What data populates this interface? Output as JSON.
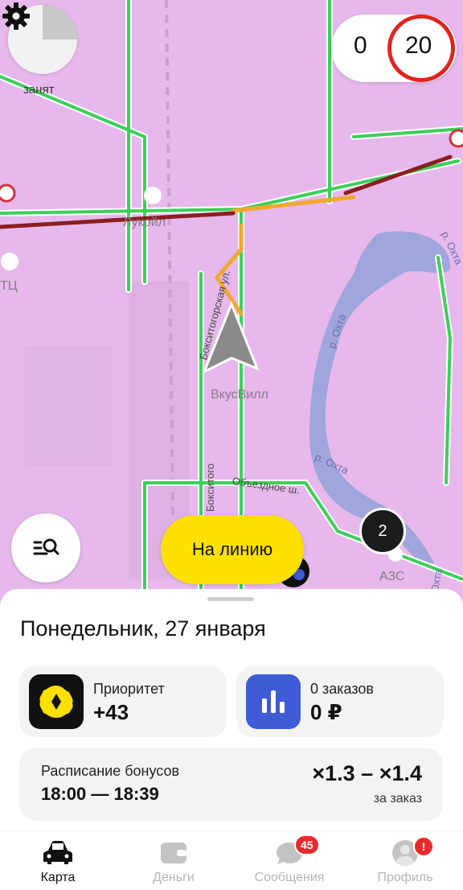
{
  "map": {
    "status_label": "занят",
    "counter_value": "0",
    "speed_limit": "20",
    "poi_lukoil": "Лукойл",
    "poi_tc": "ТЦ",
    "poi_vkusvill": "ВкусВилл",
    "poi_azs": "АЗС",
    "street_boksitogorskaya": "Бокситогорская ул.",
    "street_boksitogo": "Бокситого",
    "street_obezdnoe": "Объездное ш.",
    "river_1": "р. Охта",
    "river_2": "р. Охта",
    "river_3": "р. Охта",
    "river_4": "Охта",
    "cluster_count": "2",
    "online_button": "На линию",
    "colors": {
      "map_bg": "#e7b8ec",
      "road_green": "#3ccf5a",
      "road_orange": "#f0a830",
      "road_red": "#8b1e22",
      "river": "#9ea6dc",
      "accent_yellow": "#fce000"
    }
  },
  "sheet": {
    "date_title": "Понедельник, 27 января",
    "priority": {
      "title": "Приоритет",
      "value": "+43",
      "icon": "priority-icon"
    },
    "orders": {
      "title": "0 заказов",
      "value": "0 ₽",
      "icon": "bar-chart-icon"
    },
    "bonus": {
      "title": "Расписание бонусов",
      "time": "18:00 — 18:39",
      "multiplier": "×1.3 – ×1.4",
      "per_order": "за заказ"
    }
  },
  "tabs": [
    {
      "label": "Карта",
      "icon": "car-icon",
      "active": true
    },
    {
      "label": "Деньги",
      "icon": "wallet-icon",
      "active": false
    },
    {
      "label": "Сообщения",
      "icon": "chat-icon",
      "active": false,
      "badge": "45"
    },
    {
      "label": "Профиль",
      "icon": "profile-icon",
      "active": false,
      "badge": "!"
    }
  ]
}
